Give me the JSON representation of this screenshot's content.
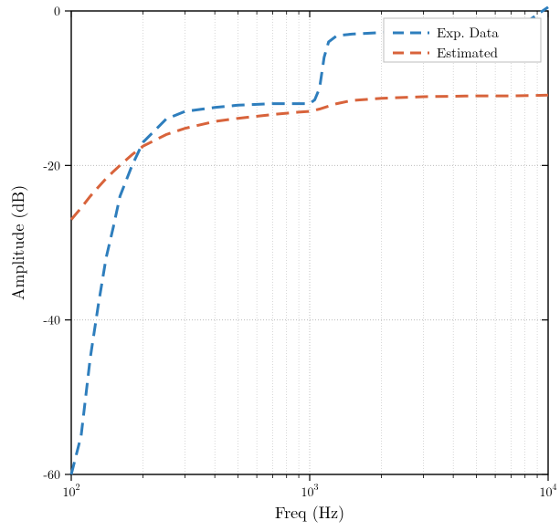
{
  "chart_data": {
    "type": "line",
    "title": "",
    "xlabel": "Freq (Hz)",
    "ylabel": "Amplitude (dB)",
    "xscale": "log",
    "xlim": [
      100,
      10000
    ],
    "ylim": [
      -60,
      0
    ],
    "xticks_major": [
      100,
      1000,
      10000
    ],
    "xtick_labels": [
      "10^2",
      "10^3",
      "10^4"
    ],
    "yticks": [
      -60,
      -40,
      -20,
      0
    ],
    "ytick_labels": [
      "-60",
      "-40",
      "-20",
      "0"
    ],
    "legend": {
      "position": "upper right",
      "entries": [
        "Exp. Data",
        "Estimated"
      ]
    },
    "colors": {
      "exp": "#2e7ebd",
      "est": "#d8633b",
      "frame": "#000000",
      "grid": "#b0b0b0"
    },
    "series": [
      {
        "name": "Exp. Data",
        "color": "#2e7ebd",
        "x": [
          100,
          110,
          120,
          130,
          140,
          150,
          160,
          180,
          200,
          250,
          300,
          400,
          500,
          700,
          900,
          1000,
          1050,
          1100,
          1150,
          1200,
          1300,
          1500,
          2000,
          3000,
          5000,
          7000,
          8500,
          10000
        ],
        "y": [
          -60,
          -55,
          -45,
          -38,
          -32,
          -28,
          -24,
          -20,
          -17,
          -14,
          -13,
          -12.5,
          -12.2,
          -12,
          -12,
          -12,
          -11.5,
          -10,
          -6,
          -4,
          -3.2,
          -3,
          -2.8,
          -2.6,
          -2.3,
          -1.8,
          -1,
          0.5
        ]
      },
      {
        "name": "Estimated",
        "color": "#d8633b",
        "x": [
          100,
          110,
          120,
          130,
          140,
          150,
          160,
          180,
          200,
          250,
          300,
          400,
          500,
          700,
          900,
          1000,
          1100,
          1300,
          1500,
          2000,
          3000,
          5000,
          7000,
          10000
        ],
        "y": [
          -27,
          -25.5,
          -24,
          -22.8,
          -21.7,
          -20.8,
          -20,
          -18.6,
          -17.5,
          -16,
          -15.2,
          -14.3,
          -13.9,
          -13.4,
          -13.1,
          -13,
          -12.7,
          -12,
          -11.6,
          -11.3,
          -11.1,
          -11,
          -11,
          -10.9
        ]
      }
    ]
  }
}
